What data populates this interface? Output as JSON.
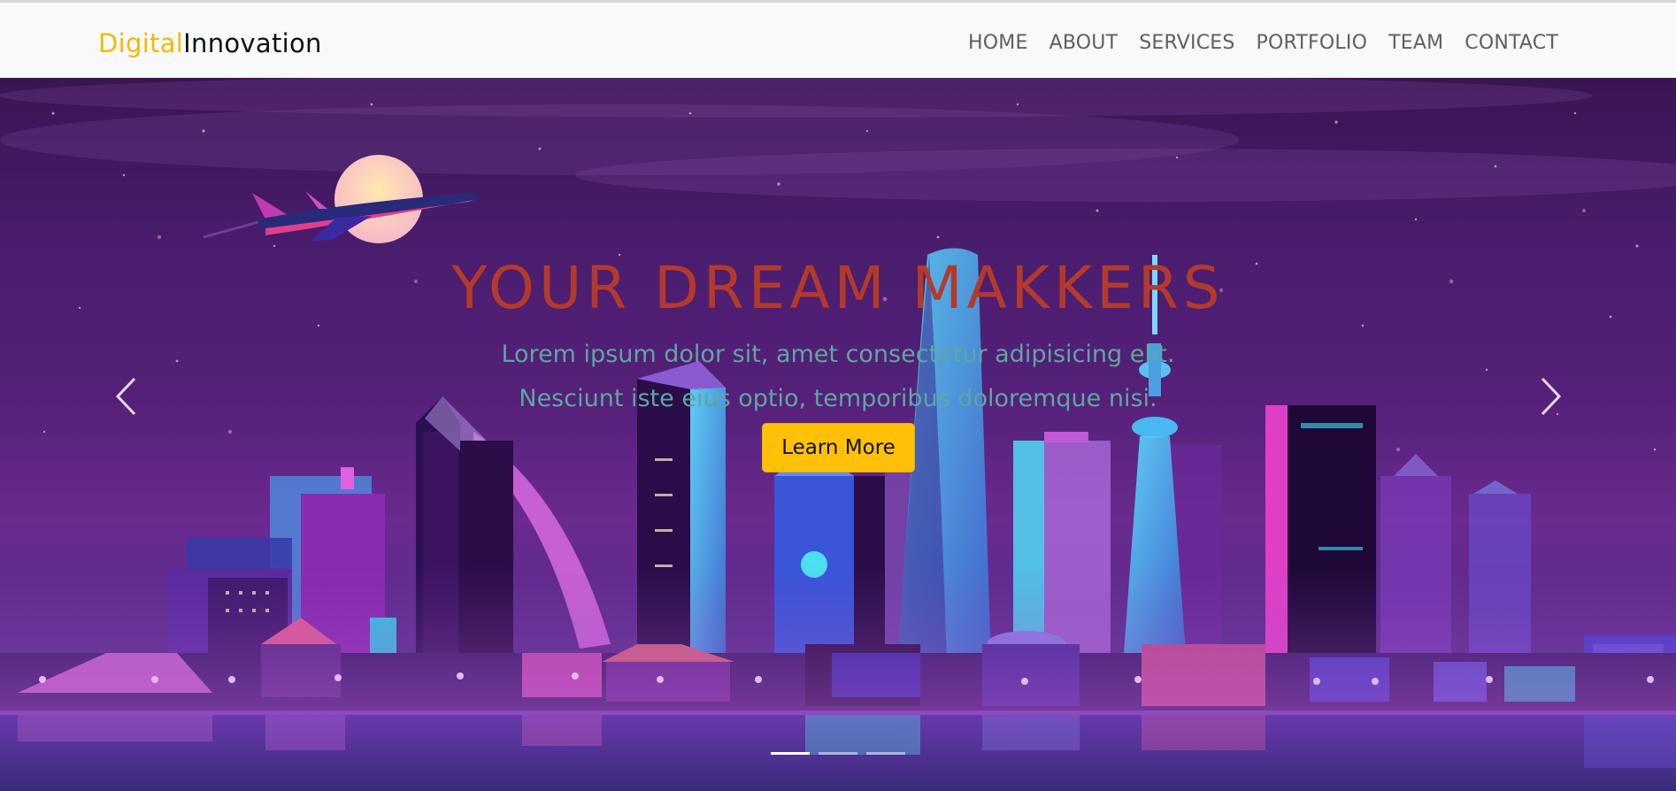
{
  "brand": {
    "accent": "Digital",
    "rest": "Innovation"
  },
  "nav": {
    "items": [
      {
        "label": "HOME"
      },
      {
        "label": "ABOUT"
      },
      {
        "label": "SERVICES"
      },
      {
        "label": "PORTFOLIO"
      },
      {
        "label": "TEAM"
      },
      {
        "label": "CONTACT"
      }
    ]
  },
  "hero": {
    "title": "YOUR DREAM MAKKERS",
    "subtitle_line1": "Lorem ipsum dolor sit, amet consectetur adipisicing elit.",
    "subtitle_line2": "Nesciunt iste eius optio, temporibus doloremque nisi.",
    "cta_label": "Learn More",
    "slides": 3,
    "active_slide": 1
  },
  "colors": {
    "brand_accent": "#f5b800",
    "title": "#b33a2b",
    "subtitle": "#5fa6a0",
    "cta_bg": "#ffc107",
    "navbar_bg": "#f8f9fa"
  },
  "icons": {
    "prev": "chevron-left-icon",
    "next": "chevron-right-icon"
  }
}
